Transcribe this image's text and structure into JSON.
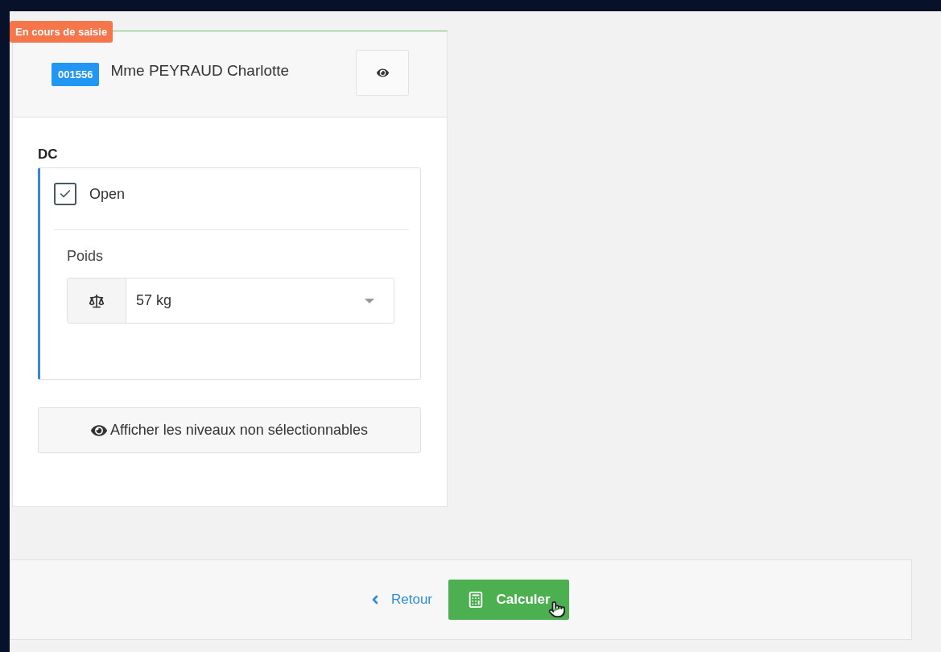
{
  "status_badge": "En cours de saisie",
  "patient": {
    "id": "001556",
    "name": "Mme PEYRAUD Charlotte"
  },
  "section": {
    "title": "DC",
    "option": {
      "label": "Open",
      "checked": true
    },
    "field": {
      "label": "Poids",
      "value": "57 kg"
    }
  },
  "show_levels_button": "Afficher les niveaux non sélectionnables",
  "footer": {
    "back_link": "Retour",
    "calculate_button": "Calculer"
  }
}
